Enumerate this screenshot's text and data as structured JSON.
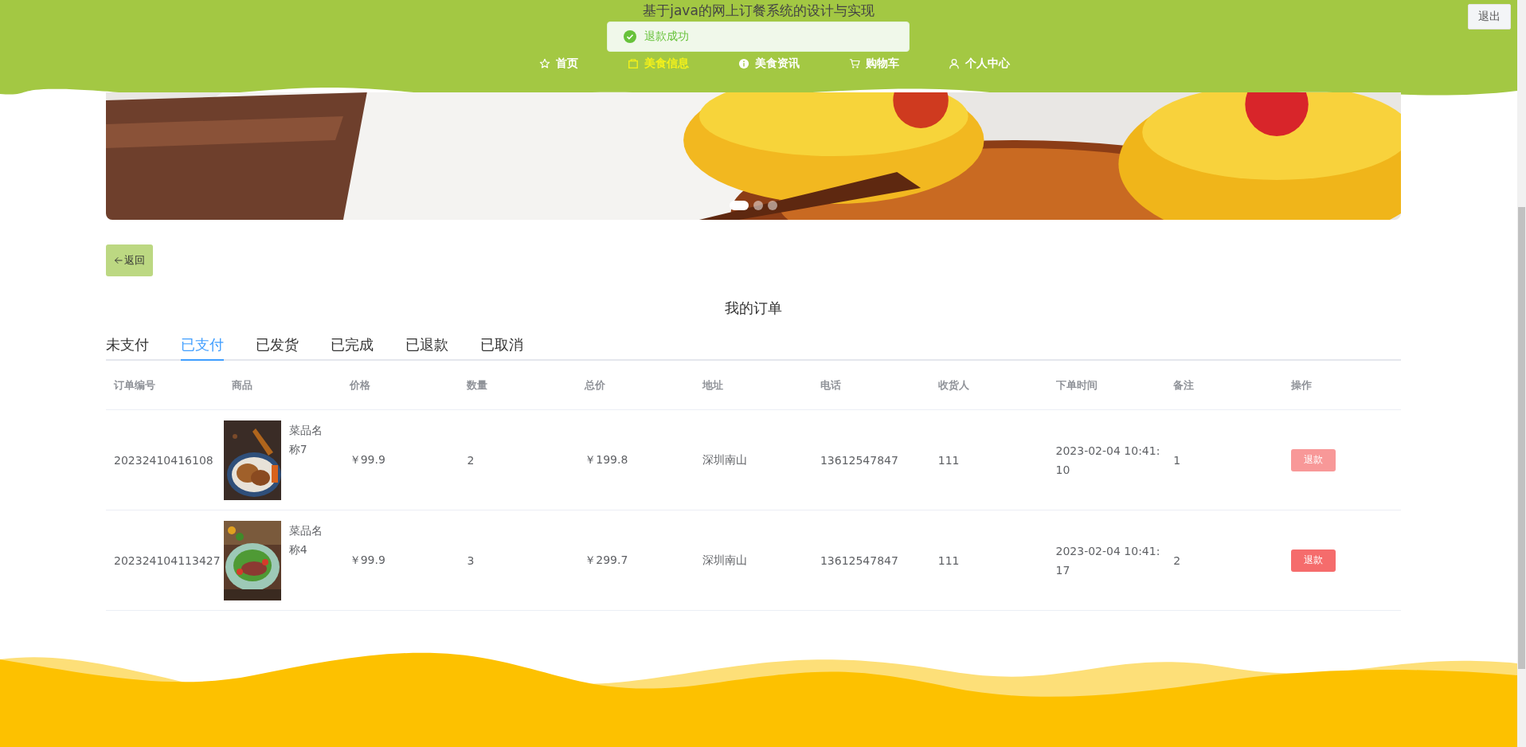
{
  "header": {
    "title": "基于java的网上订餐系统的设计与实现",
    "logout": "退出",
    "nav": [
      {
        "label": "首页",
        "selected": false
      },
      {
        "label": "美食信息",
        "selected": true
      },
      {
        "label": "美食资讯",
        "selected": false
      },
      {
        "label": "购物车",
        "selected": false
      },
      {
        "label": "个人中心",
        "selected": false
      }
    ]
  },
  "toast": {
    "kind": "success",
    "message": "退款成功"
  },
  "banner": {
    "kind": "picture",
    "dots": [
      {
        "selected": true
      },
      {
        "selected": false
      },
      {
        "selected": false
      }
    ]
  },
  "back_button": "返回",
  "page_title": "我的订单",
  "tabs": [
    {
      "label": "未支付",
      "selected": false
    },
    {
      "label": "已支付",
      "selected": true
    },
    {
      "label": "已发货",
      "selected": false
    },
    {
      "label": "已完成",
      "selected": false
    },
    {
      "label": "已退款",
      "selected": false
    },
    {
      "label": "已取消",
      "selected": false
    }
  ],
  "table": {
    "columns": [
      "订单编号",
      "商品",
      "价格",
      "数量",
      "总价",
      "地址",
      "电话",
      "收货人",
      "下单时间",
      "备注",
      "操作"
    ],
    "rows": [
      {
        "order_no": "20232410416108",
        "product": {
          "kind": "picture",
          "name": "菜品名称7"
        },
        "price": "￥99.9",
        "quantity": "2",
        "total": "￥199.8",
        "address": "深圳南山",
        "phone": "13612547847",
        "receiver": "111",
        "time": "2023-02-04 10:41:10",
        "note": "1",
        "action": {
          "label": "退款",
          "disabled": true
        }
      },
      {
        "order_no": "202324104113427",
        "product": {
          "kind": "picture",
          "name": "菜品名称4"
        },
        "price": "￥99.9",
        "quantity": "3",
        "total": "￥299.7",
        "address": "深圳南山",
        "phone": "13612547847",
        "receiver": "111",
        "time": "2023-02-04 10:41:17",
        "note": "2",
        "action": {
          "label": "退款",
          "disabled": false
        }
      }
    ]
  }
}
